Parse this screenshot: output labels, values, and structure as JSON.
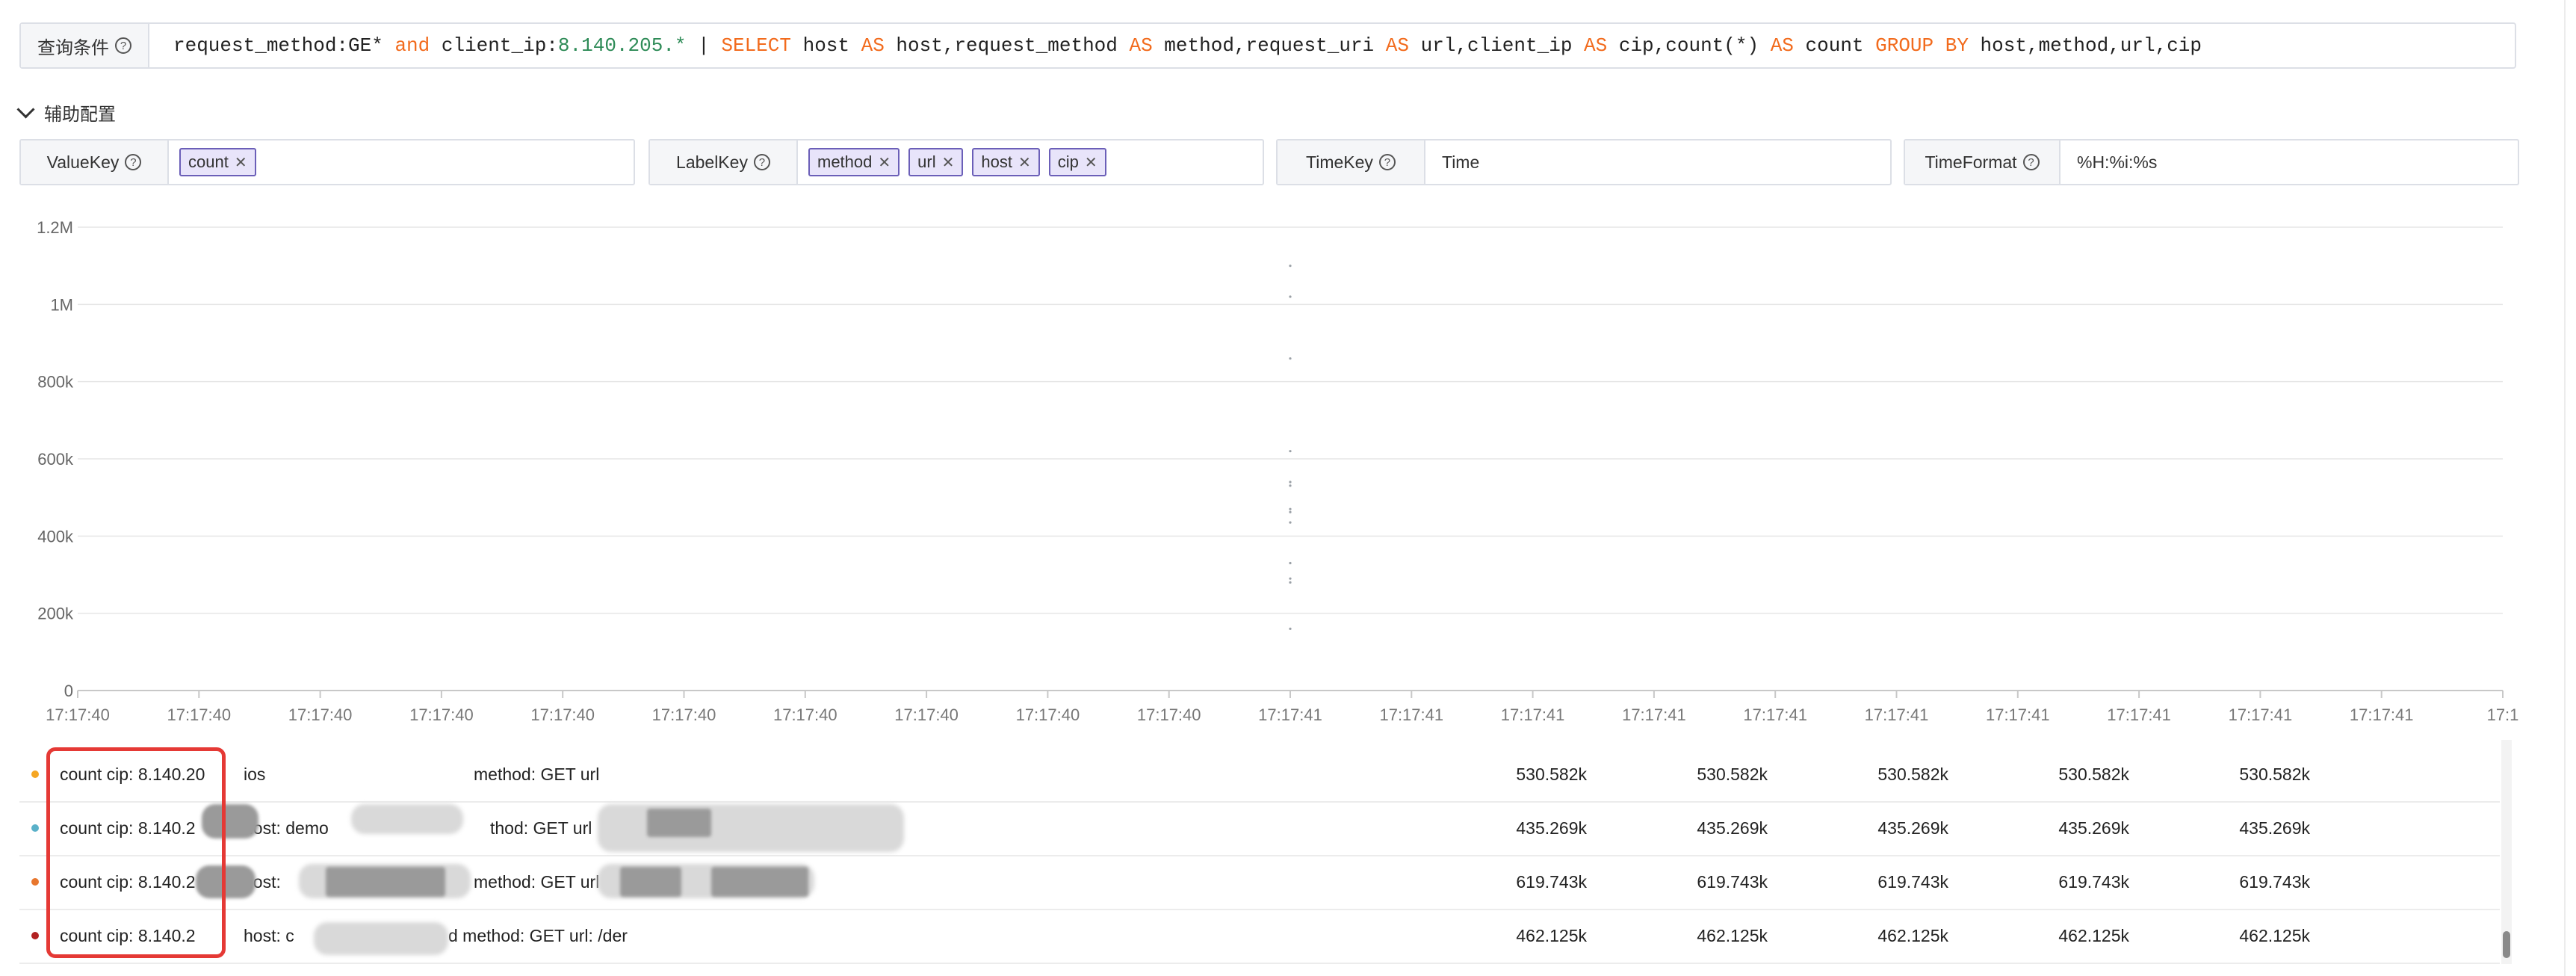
{
  "query": {
    "label": "查询条件",
    "parts": {
      "p1": "request_method:GE* ",
      "p2": "and",
      "p3": " client_ip:",
      "p4": "8.140.205.*",
      "p5": " | ",
      "p6": "SELECT",
      "p7": " host ",
      "p8": "AS",
      "p9": " host,request_method ",
      "p10": "AS",
      "p11": " method,request_uri ",
      "p12": "AS",
      "p13": " url,client_ip ",
      "p14": "AS",
      "p15": " cip,count(*) ",
      "p16": "AS",
      "p17": " count ",
      "p18": "GROUP BY",
      "p19": " host,method,url,cip"
    }
  },
  "aux": {
    "label": "辅助配置"
  },
  "config": {
    "valuekey": {
      "label": "ValueKey",
      "tags": [
        "count"
      ]
    },
    "labelkey": {
      "label": "LabelKey",
      "tags": [
        "method",
        "url",
        "host",
        "cip"
      ]
    },
    "timekey": {
      "label": "TimeKey",
      "value": "Time"
    },
    "timeformat": {
      "label": "TimeFormat",
      "value": "%H:%i:%s"
    }
  },
  "chart_data": {
    "type": "scatter",
    "y_ticks": [
      "0",
      "200k",
      "400k",
      "600k",
      "800k",
      "1M",
      "1.2M"
    ],
    "ylim": [
      0,
      1200000
    ],
    "x_ticks": [
      "17:17:40",
      "17:17:40",
      "17:17:40",
      "17:17:40",
      "17:17:40",
      "17:17:40",
      "17:17:40",
      "17:17:40",
      "17:17:40",
      "17:17:40",
      "17:17:41",
      "17:17:41",
      "17:17:41",
      "17:17:41",
      "17:17:41",
      "17:17:41",
      "17:17:41",
      "17:17:41",
      "17:17:41",
      "17:17:41",
      "17:1"
    ],
    "grid": true,
    "points": [
      {
        "x": "17:17:41",
        "y": 1100000
      },
      {
        "x": "17:17:41",
        "y": 1020000
      },
      {
        "x": "17:17:41",
        "y": 860000
      },
      {
        "x": "17:17:41",
        "y": 620000
      },
      {
        "x": "17:17:41",
        "y": 540000
      },
      {
        "x": "17:17:41",
        "y": 530582
      },
      {
        "x": "17:17:41",
        "y": 470000
      },
      {
        "x": "17:17:41",
        "y": 462125
      },
      {
        "x": "17:17:41",
        "y": 435269
      },
      {
        "x": "17:17:41",
        "y": 330000
      },
      {
        "x": "17:17:41",
        "y": 290000
      },
      {
        "x": "17:17:41",
        "y": 280000
      },
      {
        "x": "17:17:41",
        "y": 160000
      }
    ]
  },
  "table": {
    "rows": [
      {
        "color": "#f5a623",
        "label": "count cip: 8.140.20",
        "host": "ios",
        "method": "method: GET url",
        "values": [
          "530.582k",
          "530.582k",
          "530.582k",
          "530.582k",
          "530.582k"
        ]
      },
      {
        "color": "#5ab1c9",
        "label": "count cip: 8.140.2",
        "host": "host: demo",
        "method": "thod: GET url",
        "values": [
          "435.269k",
          "435.269k",
          "435.269k",
          "435.269k",
          "435.269k"
        ]
      },
      {
        "color": "#e8772e",
        "label": "count cip: 8.140.2",
        "host": "host:",
        "method": "method: GET url",
        "values": [
          "619.743k",
          "619.743k",
          "619.743k",
          "619.743k",
          "619.743k"
        ]
      },
      {
        "color": "#b22222",
        "label": "count cip: 8.140.2",
        "host": "host: c",
        "method": "d method: GET url: /der",
        "values": [
          "462.125k",
          "462.125k",
          "462.125k",
          "462.125k",
          "462.125k"
        ]
      }
    ]
  }
}
